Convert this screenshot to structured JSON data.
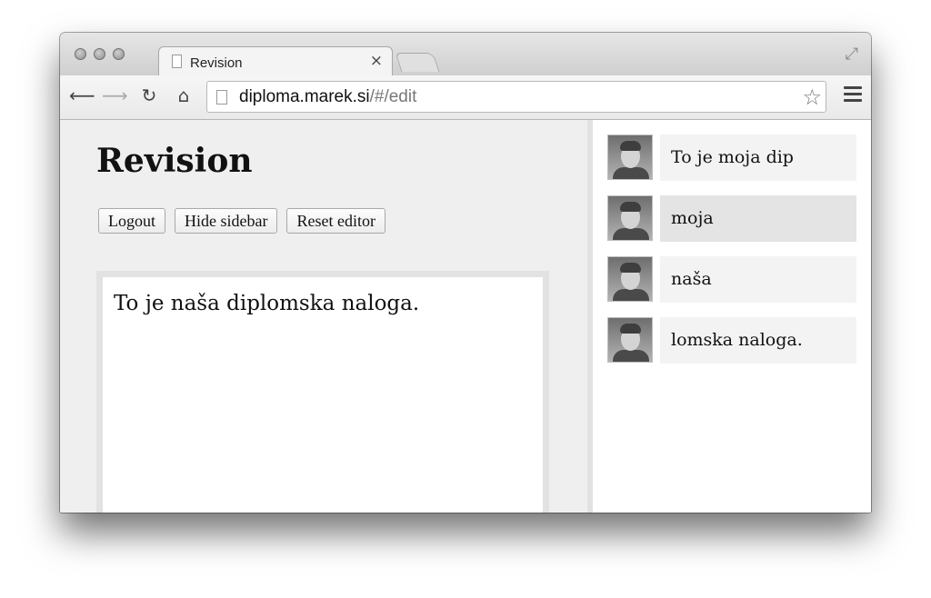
{
  "browser": {
    "tab_title": "Revision",
    "tab_close": "×",
    "url_host": "diploma.marek.si",
    "url_path": "/#/edit"
  },
  "page": {
    "title": "Revision",
    "buttons": {
      "logout": "Logout",
      "hide_sidebar": "Hide sidebar",
      "reset_editor": "Reset editor"
    },
    "editor_text": "To je naša diplomska naloga."
  },
  "sidebar": {
    "revisions": [
      {
        "text": "To je moja dip"
      },
      {
        "text": "moja",
        "active": true
      },
      {
        "text": "naša"
      },
      {
        "text": "lomska naloga."
      }
    ]
  }
}
